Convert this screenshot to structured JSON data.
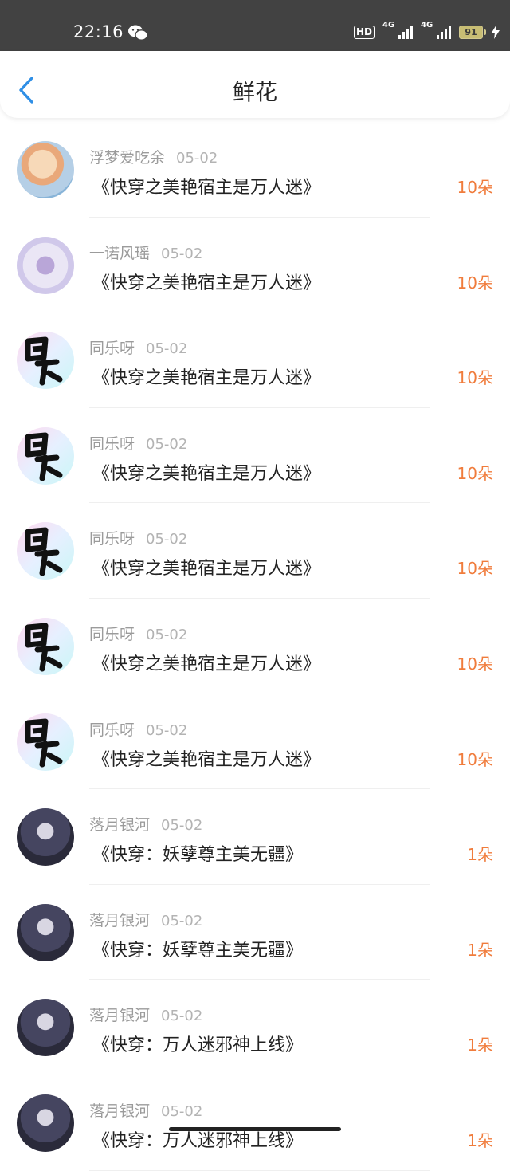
{
  "status_bar": {
    "time": "22:16",
    "hd_label": "HD",
    "signal_1_label": "4G",
    "signal_2_label": "4G",
    "battery": "91",
    "icons": [
      "wechat-icon",
      "signal-icon",
      "battery-icon",
      "charging-icon"
    ]
  },
  "header": {
    "title": "鲜花",
    "back_icon": "chevron-left-icon"
  },
  "colors": {
    "accent_blue": "#2f8fe6",
    "flower_count": "#f07c3c",
    "status_bar_bg": "#424242"
  },
  "items": [
    {
      "user": "浮梦爱吃余",
      "date": "05-02",
      "book": "《快穿之美艳宿主是万人迷》",
      "count": "10朵",
      "avatar": "anime-avatar"
    },
    {
      "user": "一诺风瑶",
      "date": "05-02",
      "book": "《快穿之美艳宿主是万人迷》",
      "count": "10朵",
      "avatar": "purple-avatar"
    },
    {
      "user": "同乐呀",
      "date": "05-02",
      "book": "《快穿之美艳宿主是万人迷》",
      "count": "10朵",
      "avatar": "tongle-avatar"
    },
    {
      "user": "同乐呀",
      "date": "05-02",
      "book": "《快穿之美艳宿主是万人迷》",
      "count": "10朵",
      "avatar": "tongle-avatar"
    },
    {
      "user": "同乐呀",
      "date": "05-02",
      "book": "《快穿之美艳宿主是万人迷》",
      "count": "10朵",
      "avatar": "tongle-avatar"
    },
    {
      "user": "同乐呀",
      "date": "05-02",
      "book": "《快穿之美艳宿主是万人迷》",
      "count": "10朵",
      "avatar": "tongle-avatar"
    },
    {
      "user": "同乐呀",
      "date": "05-02",
      "book": "《快穿之美艳宿主是万人迷》",
      "count": "10朵",
      "avatar": "tongle-avatar"
    },
    {
      "user": "落月银河",
      "date": "05-02",
      "book": "《快穿：妖孽尊主美无疆》",
      "count": "1朵",
      "avatar": "dark-anime-avatar"
    },
    {
      "user": "落月银河",
      "date": "05-02",
      "book": "《快穿：妖孽尊主美无疆》",
      "count": "1朵",
      "avatar": "dark-anime-avatar"
    },
    {
      "user": "落月银河",
      "date": "05-02",
      "book": "《快穿：万人迷邪神上线》",
      "count": "1朵",
      "avatar": "dark-anime-avatar"
    },
    {
      "user": "落月银河",
      "date": "05-02",
      "book": "《快穿：万人迷邪神上线》",
      "count": "1朵",
      "avatar": "dark-anime-avatar"
    }
  ]
}
